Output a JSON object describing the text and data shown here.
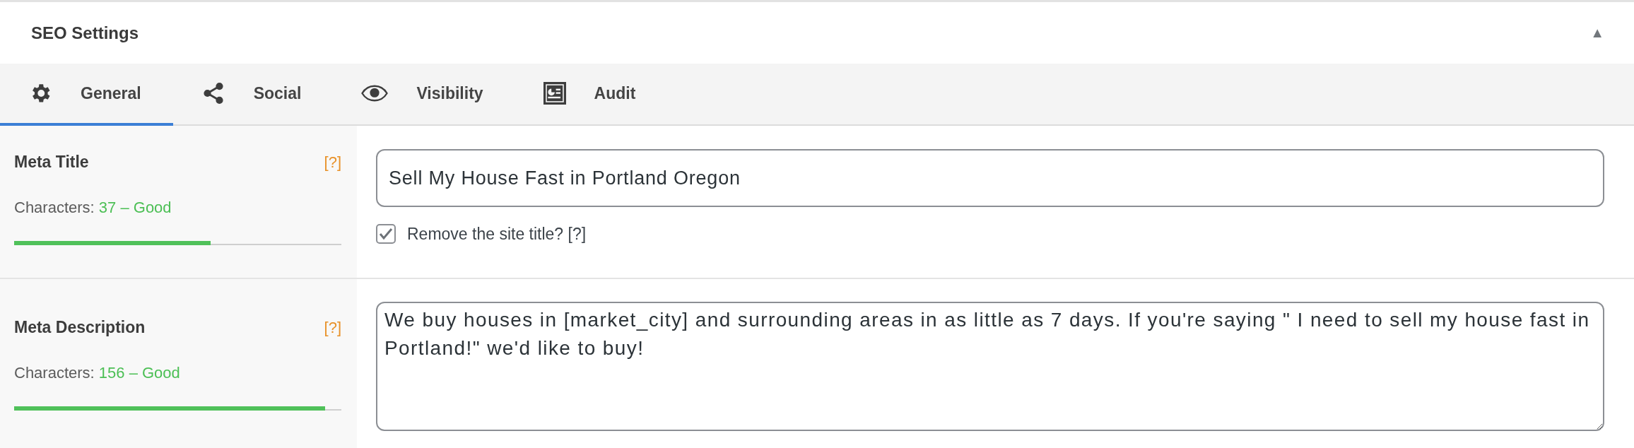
{
  "panel": {
    "title": "SEO Settings",
    "collapse_icon": "▲",
    "expanded": true
  },
  "tabs": [
    {
      "label": "General",
      "kind": "gear",
      "selected": true
    },
    {
      "label": "Social",
      "kind": "share",
      "selected": false
    },
    {
      "label": "Visibility",
      "kind": "eye",
      "selected": false
    },
    {
      "label": "Audit",
      "kind": "audit",
      "selected": false
    }
  ],
  "fields": [
    {
      "kind": "input",
      "label": "Meta Title",
      "help": "[?]",
      "counter_label": "Characters:",
      "counter_value": "37 – Good",
      "level": 0.6,
      "value": "Sell My House Fast in Portland Oregon",
      "checkbox": {
        "label": "Remove the site title? [?]",
        "checked": true
      }
    },
    {
      "kind": "textarea",
      "label": "Meta Description",
      "help": "[?]",
      "counter_label": "Characters:",
      "counter_value": "156 – Good",
      "level": 0.95,
      "value": "We buy houses in [market_city] and surrounding areas in as little as 7 days. If you're saying \" I need to sell my house fast in Portland!\" we'd like to buy!"
    }
  ]
}
